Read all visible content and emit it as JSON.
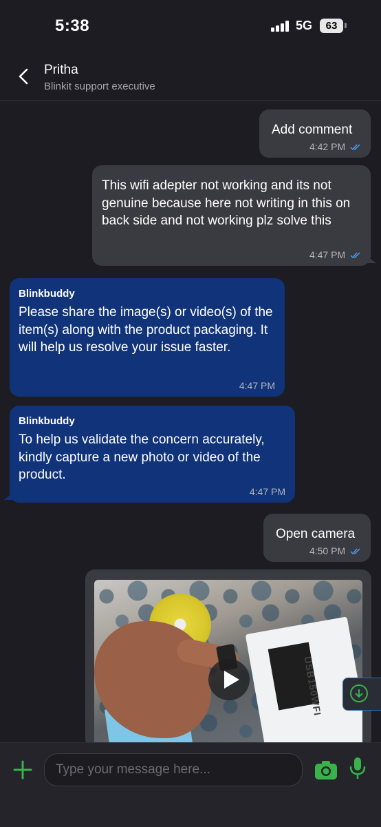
{
  "status_bar": {
    "time": "5:38",
    "network": "5G",
    "battery": "63"
  },
  "header": {
    "name": "Pritha",
    "role": "Blinkit support executive"
  },
  "messages": [
    {
      "text": "Add comment",
      "time": "4:42 PM"
    },
    {
      "text": "This wifi adepter not working and its not genuine because here not writing in this on back side and not working plz solve this",
      "time": "4:47 PM"
    },
    {
      "sender": "Blinkbuddy",
      "text": "Please share the image(s) or video(s) of the item(s) along with the product packaging. It will help us resolve your issue faster.",
      "time": "4:47 PM"
    },
    {
      "sender": "Blinkbuddy",
      "text": "To help us validate the concern accurately, kindly capture a new photo or video of the product.",
      "time": "4:47 PM"
    },
    {
      "text": "Open camera",
      "time": "4:50 PM"
    }
  ],
  "video": {
    "pack_text": "USB150WFI"
  },
  "composer": {
    "placeholder": "Type your message here..."
  },
  "colors": {
    "accent": "#39b24a",
    "incoming_bubble": "#10337a",
    "outgoing_bubble": "#3a3a41",
    "tick": "#4a9df0"
  },
  "icons": [
    "back-arrow-icon",
    "double-tick-icon",
    "play-icon",
    "download-arrow-icon",
    "plus-icon",
    "camera-icon",
    "mic-icon"
  ]
}
